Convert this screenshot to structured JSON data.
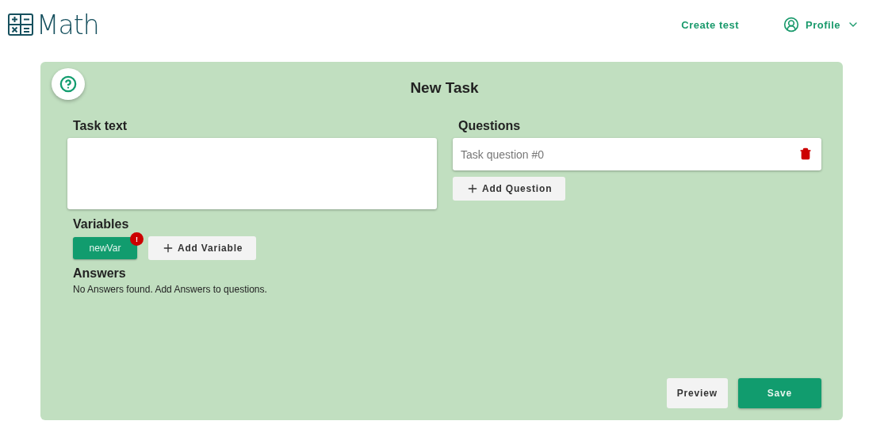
{
  "header": {
    "logo": "Math",
    "nav": [
      {
        "label": "Create test",
        "kind": "link"
      },
      {
        "label": "Profile",
        "kind": "menu"
      }
    ]
  },
  "card": {
    "title": "New Task",
    "task_text": {
      "label": "Task text"
    },
    "variables": {
      "label": "Variables",
      "items": [
        {
          "name": "newVar",
          "badge": "!"
        }
      ],
      "add_button": "Add Variable"
    },
    "answers": {
      "label": "Answers",
      "message": "No Answers found. Add Answers to questions."
    },
    "questions": {
      "label": "Questions",
      "items": [
        {
          "placeholder": "Task question #0"
        }
      ],
      "add_button": "Add Question"
    },
    "actions": [
      {
        "label": "Preview",
        "kind": "secondary"
      },
      {
        "label": "Save",
        "kind": "primary"
      }
    ]
  }
}
